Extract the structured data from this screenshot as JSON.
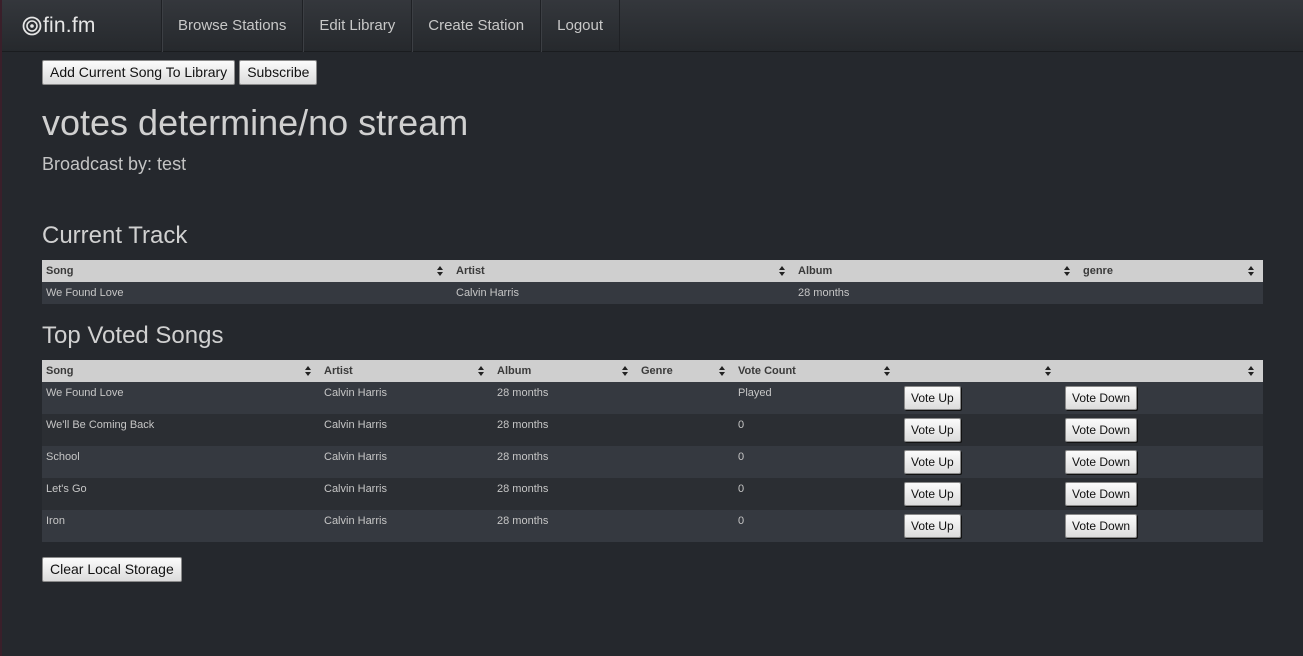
{
  "nav": {
    "brand": "fin.fm",
    "items": [
      {
        "label": "Browse Stations"
      },
      {
        "label": "Edit Library"
      },
      {
        "label": "Create Station"
      },
      {
        "label": "Logout"
      }
    ]
  },
  "actions": {
    "add_song": "Add Current Song To Library",
    "subscribe": "Subscribe",
    "clear_storage": "Clear Local Storage"
  },
  "station": {
    "title": "votes determine/no stream",
    "broadcast": "Broadcast by: test"
  },
  "current_track": {
    "title": "Current Track",
    "headers": [
      "Song",
      "Artist",
      "Album",
      "genre"
    ],
    "row": {
      "song": "We Found Love",
      "artist": "Calvin Harris",
      "album": "28 months",
      "genre": ""
    }
  },
  "top_voted": {
    "title": "Top Voted Songs",
    "headers": [
      "Song",
      "Artist",
      "Album",
      "Genre",
      "Vote Count",
      "",
      ""
    ],
    "vote_up_label": "Vote Up",
    "vote_down_label": "Vote Down",
    "rows": [
      {
        "song": "We Found Love",
        "artist": "Calvin Harris",
        "album": "28 months",
        "genre": "",
        "votes": "Played"
      },
      {
        "song": "We'll Be Coming Back",
        "artist": "Calvin Harris",
        "album": "28 months",
        "genre": "",
        "votes": "0"
      },
      {
        "song": "School",
        "artist": "Calvin Harris",
        "album": "28 months",
        "genre": "",
        "votes": "0"
      },
      {
        "song": "Let's Go",
        "artist": "Calvin Harris",
        "album": "28 months",
        "genre": "",
        "votes": "0"
      },
      {
        "song": "Iron",
        "artist": "Calvin Harris",
        "album": "28 months",
        "genre": "",
        "votes": "0"
      }
    ]
  }
}
